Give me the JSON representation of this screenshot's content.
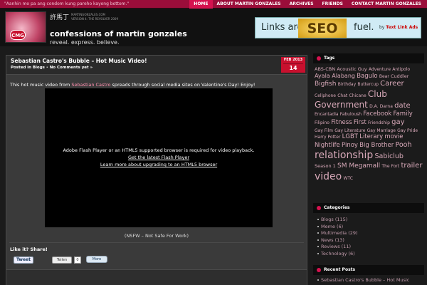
{
  "topbar": {
    "quote": "\"Aanhin mo pa ang condom kung pareho kayong bottom.\"",
    "nav": [
      {
        "label": "HOME",
        "active": true
      },
      {
        "label": "ABOUT MARTIN GONZALES",
        "active": false
      },
      {
        "label": "ARCHIVES",
        "active": false
      },
      {
        "label": "FRIENDS",
        "active": false
      },
      {
        "label": "CONTACT MARTIN GONZALES",
        "active": false
      }
    ]
  },
  "header": {
    "logo_text": "CMG",
    "logo_chinese": "許馬丁",
    "logo_domain": "MARTINGONZALES.COM",
    "logo_version": "VERSION 4: THE REVOLVER 2009",
    "title": "confessions of martin gonzales",
    "tagline": "reveal. express. believe."
  },
  "ad": {
    "text_left": "Links are",
    "text_seo": "SEO",
    "text_right": "fuel.",
    "by_text": "by",
    "brand": "Text Link Ads"
  },
  "post": {
    "title": "Sebastian Castro's Bubble – Hot Music Video!",
    "posted_in": "Posted in",
    "category": "Blogs",
    "separator": " • ",
    "comments": "No Comments yet »",
    "date_month": "FEB 2013",
    "date_day": "14",
    "intro_before": "This hot music video from ",
    "intro_link": "Sebastian Castro",
    "intro_after": " spreads through social media sites on Valentine's Day! Enjoy!",
    "flash_message": "Adobe Flash Player or an HTML5 supported browser is required for video playback.",
    "flash_link1": "Get the latest Flash Player",
    "flash_link2": "Learn more about upgrading to an HTML5 browser",
    "nsfw": "(NSFW – Not Safe For Work)",
    "share_title": "Like it? Share!",
    "tweet_label": "Tweet",
    "gplus_label": "Teilen",
    "gplus_count": "0",
    "more_label": "More"
  },
  "sidebar": {
    "tags_title": "Tags",
    "tags": [
      {
        "text": "ABS-CBN",
        "size": 6.5
      },
      {
        "text": "Acoustic Guy",
        "size": 6.5
      },
      {
        "text": "Adventure",
        "size": 6
      },
      {
        "text": "Antipolo",
        "size": 6
      },
      {
        "text": "Ayala Alabang",
        "size": 8
      },
      {
        "text": "Bagulo",
        "size": 8.5
      },
      {
        "text": "Bear",
        "size": 6
      },
      {
        "text": "Cuddler",
        "size": 6.5
      },
      {
        "text": "Bigfish",
        "size": 9
      },
      {
        "text": "Birthday",
        "size": 6
      },
      {
        "text": "Buttercup",
        "size": 6
      },
      {
        "text": "Career",
        "size": 10
      },
      {
        "text": "Cellphone",
        "size": 6
      },
      {
        "text": "Chat",
        "size": 6
      },
      {
        "text": "Chicane",
        "size": 6
      },
      {
        "text": "Club",
        "size": 12
      },
      {
        "text": "Government",
        "size": 12
      },
      {
        "text": "D.A.",
        "size": 6
      },
      {
        "text": "Darna",
        "size": 6
      },
      {
        "text": "date",
        "size": 10
      },
      {
        "text": "Encantadia",
        "size": 6
      },
      {
        "text": "Fabuloush",
        "size": 6
      },
      {
        "text": "Facebook",
        "size": 8.5
      },
      {
        "text": "Family",
        "size": 8.5
      },
      {
        "text": "Filipino",
        "size": 6
      },
      {
        "text": "Fitness",
        "size": 8.5
      },
      {
        "text": "First",
        "size": 8.5
      },
      {
        "text": "Friendship",
        "size": 6
      },
      {
        "text": "gay",
        "size": 10
      },
      {
        "text": "Gay Film",
        "size": 6
      },
      {
        "text": "Gay Literature",
        "size": 6
      },
      {
        "text": "Gay Marriage",
        "size": 6
      },
      {
        "text": "Gay Pride",
        "size": 6
      },
      {
        "text": "Harry Potter",
        "size": 6
      },
      {
        "text": "LGBT",
        "size": 8.5
      },
      {
        "text": "Literary",
        "size": 8.5
      },
      {
        "text": "movie",
        "size": 8.5
      },
      {
        "text": "Nightlife",
        "size": 8.5
      },
      {
        "text": "Pinoy",
        "size": 8.5
      },
      {
        "text": "Big Brother",
        "size": 8.5
      },
      {
        "text": "Pooh",
        "size": 9.5
      },
      {
        "text": "relationship",
        "size": 14
      },
      {
        "text": "Sabiclub",
        "size": 9.5
      },
      {
        "text": "Season 1",
        "size": 6.5
      },
      {
        "text": "SM Megamall",
        "size": 9
      },
      {
        "text": "The Fort",
        "size": 6
      },
      {
        "text": "trailer",
        "size": 10
      },
      {
        "text": "video",
        "size": 14
      },
      {
        "text": "WTC",
        "size": 6
      }
    ],
    "categories_title": "Categories",
    "categories": [
      "Blogs (115)",
      "Meme (6)",
      "Multimedia (29)",
      "News (13)",
      "Reviews (11)",
      "Technology (6)"
    ],
    "recent_title": "Recent Posts",
    "recent_post": "Sebastian Castro's Bubble – Hot Music"
  },
  "colors": {
    "accent": "#d5124f",
    "topbar": "#9b0d3a",
    "tag_text": "#d8a9b9",
    "background": "#1b1b1b"
  }
}
